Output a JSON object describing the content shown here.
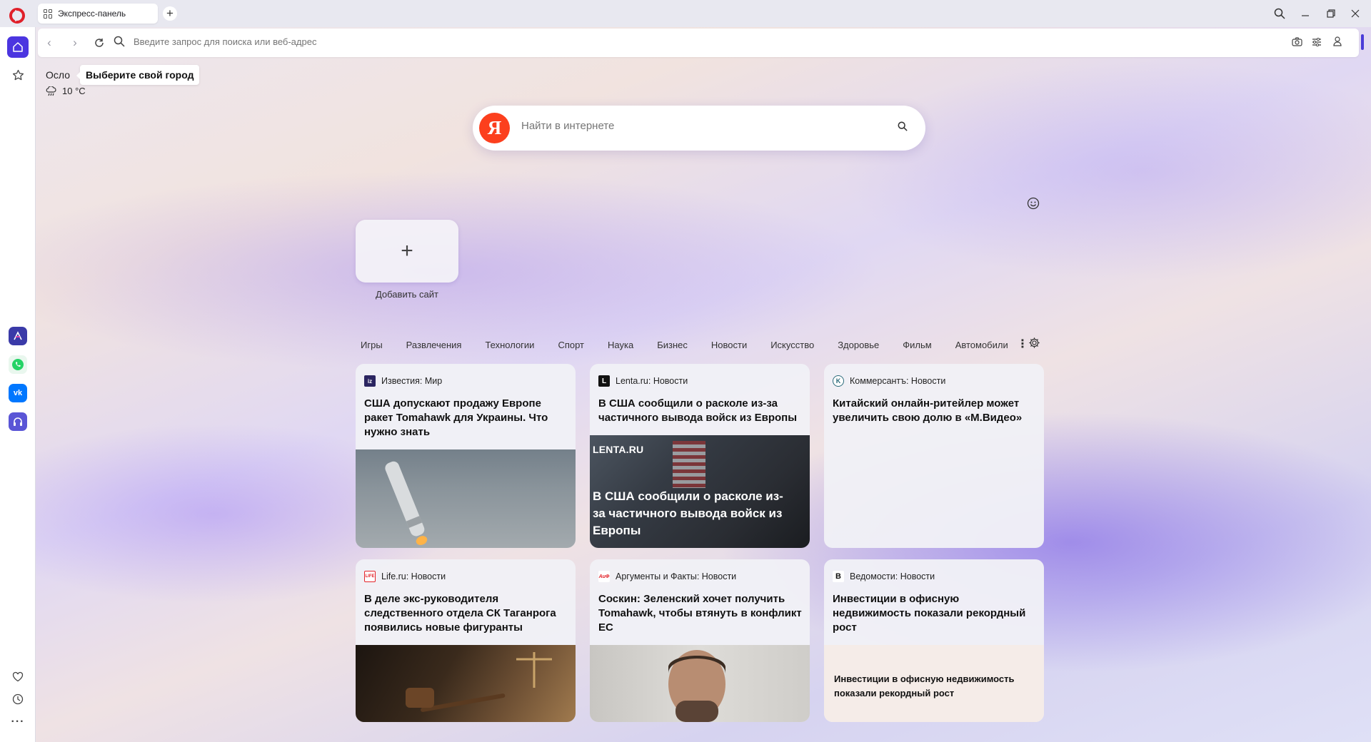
{
  "tab": {
    "title": "Экспресс-панель"
  },
  "address": {
    "placeholder": "Введите запрос для поиска или веб-адрес"
  },
  "weather": {
    "city": "Осло",
    "city_tip": "Выберите свой город",
    "temp": "10 °C"
  },
  "search": {
    "placeholder": "Найти в интернете",
    "logo": "Я"
  },
  "speed_dial": {
    "add_label": "Добавить сайт"
  },
  "categories": [
    "Игры",
    "Развлечения",
    "Технологии",
    "Спорт",
    "Наука",
    "Бизнес",
    "Новости",
    "Искусство",
    "Здоровье",
    "Фильм",
    "Автомобили"
  ],
  "news": [
    {
      "source": "Известия: Мир",
      "icon": "iz",
      "title": "США допускают продажу Европе ракет Tomahawk для Украины. Что нужно знать"
    },
    {
      "source": "Lenta.ru: Новости",
      "icon": "L",
      "title": "В США сообщили о расколе из-за частичного вывода войск из Европы",
      "image_mark": "LENTA.RU",
      "image_caption": "В США сообщили о расколе из-за частичного вывода войск из Европы"
    },
    {
      "source": "Коммерсантъ: Новости",
      "icon": "K",
      "title": "Китайский онлайн-ритейлер может увеличить свою долю в «М.Видео»"
    },
    {
      "source": "Life.ru: Новости",
      "icon": "LIFE",
      "title": "В деле экс-руководителя следственного отдела СК Таганрога появились новые фигуранты"
    },
    {
      "source": "Аргументы и Факты: Новости",
      "icon": "АиФ",
      "title": "Соскин: Зеленский хочет получить Tomahawk, чтобы втянуть в конфликт ЕС"
    },
    {
      "source": "Ведомости: Новости",
      "icon": "В",
      "title": "Инвестиции в офисную недвижимость показали рекордный рост",
      "image_text": "Инвестиции в офисную недвижимость показали рекордный рост"
    }
  ],
  "colors": {
    "accent": "#4b35e0",
    "opera_red": "#e0202a",
    "yandex_red": "#fc3f1d"
  }
}
